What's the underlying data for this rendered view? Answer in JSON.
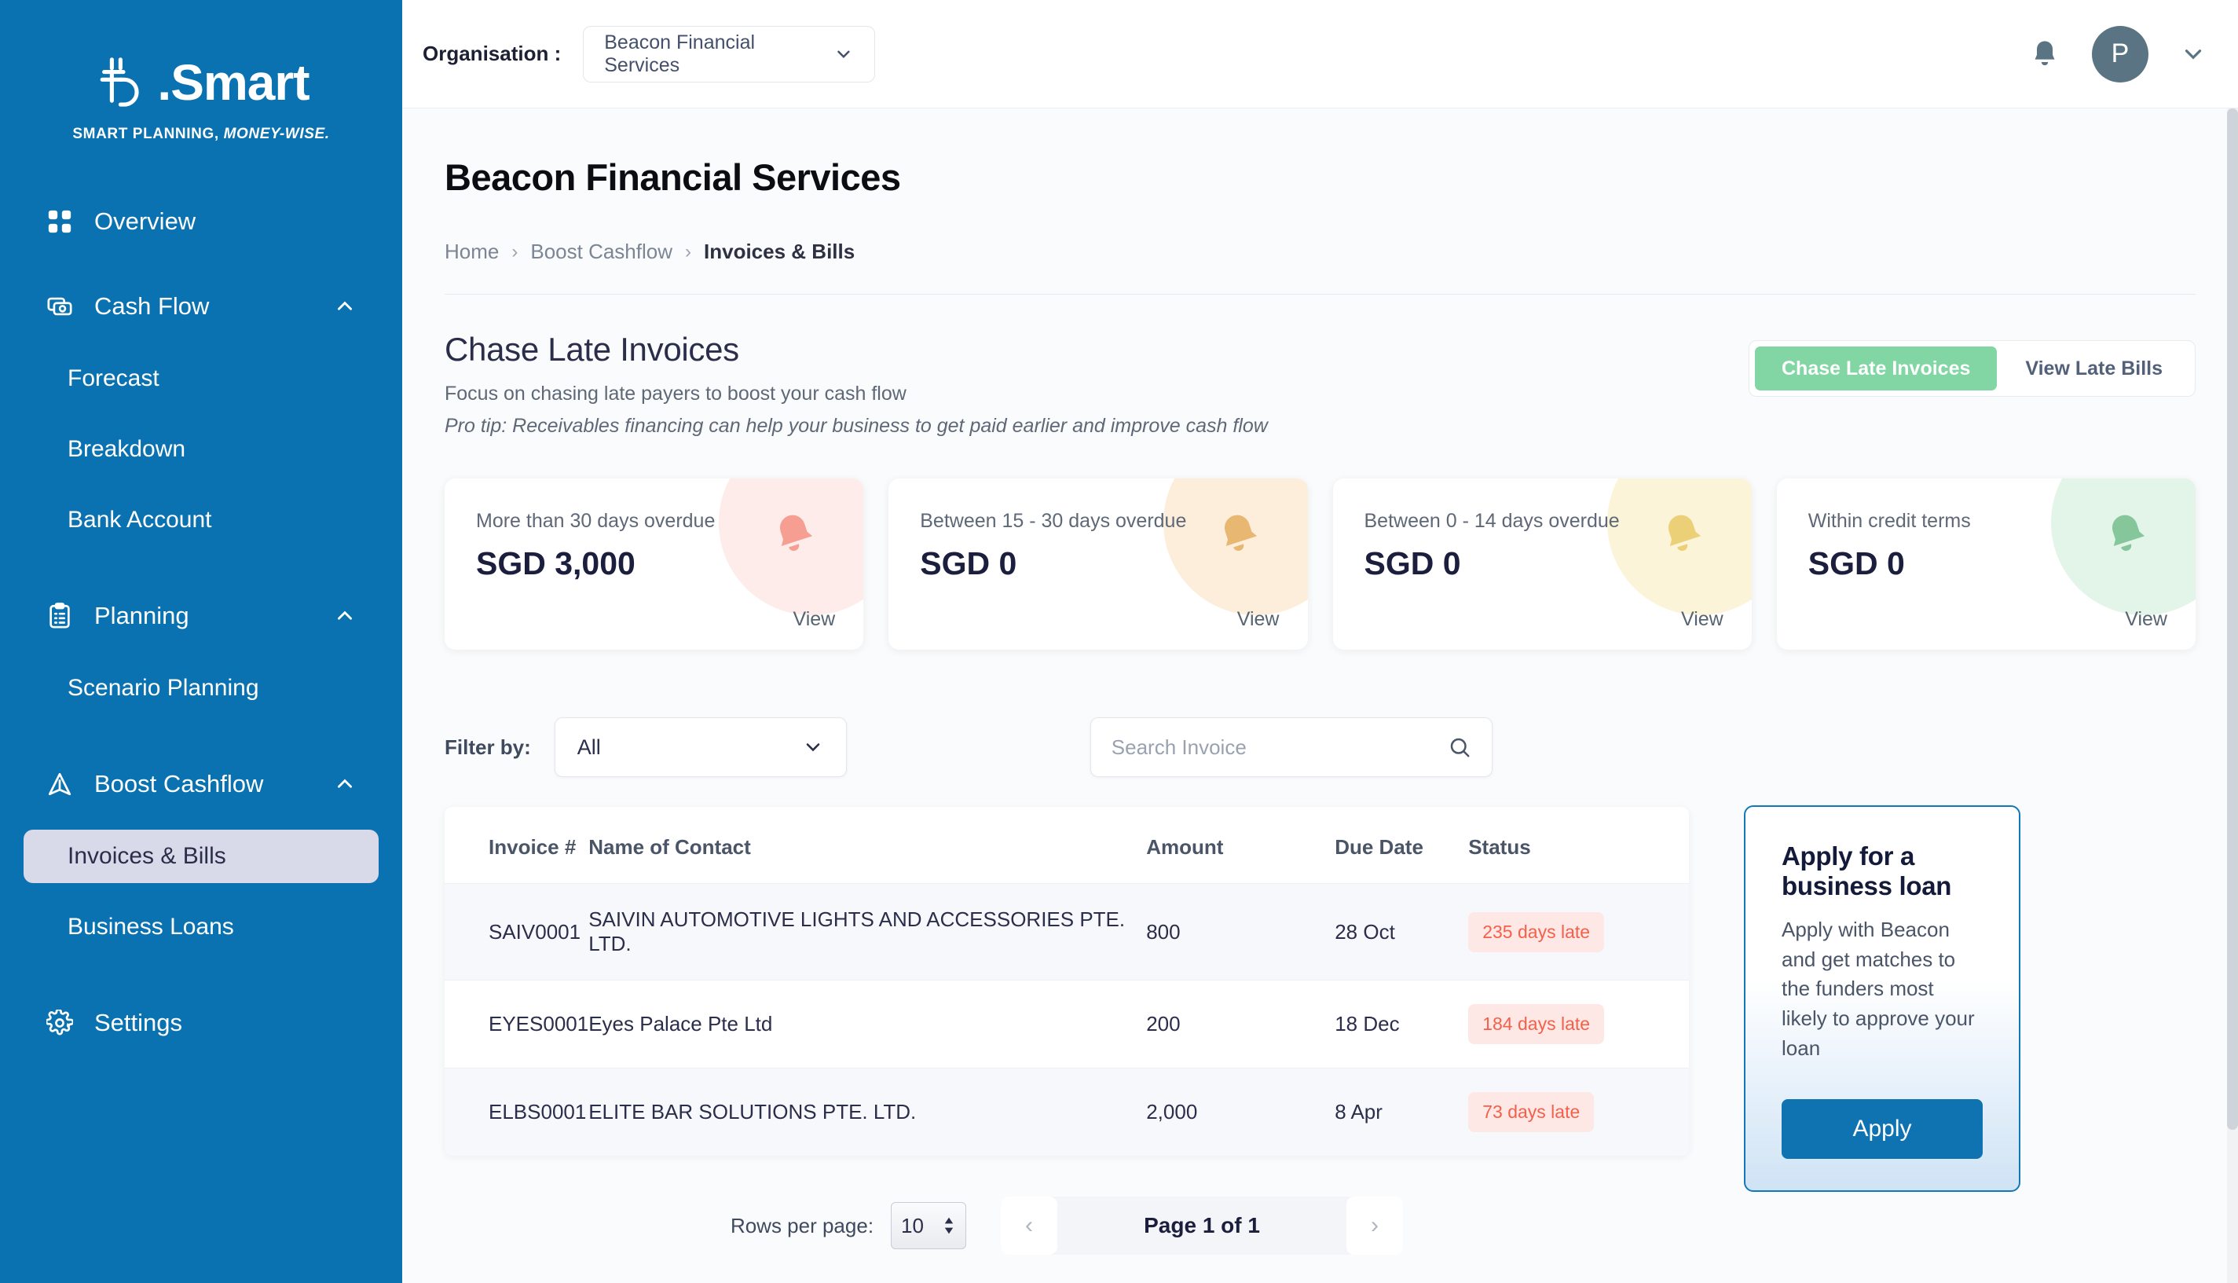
{
  "sidebar": {
    "logo_text": ".Smart",
    "logo_tagline_plain": "SMART PLANNING, ",
    "logo_tagline_italic": "MONEY-WISE.",
    "items": [
      {
        "label": "Overview",
        "icon": "grid-icon",
        "type": "item"
      },
      {
        "label": "Cash Flow",
        "icon": "money-icon",
        "type": "group",
        "expanded": true
      },
      {
        "label": "Forecast",
        "type": "sub"
      },
      {
        "label": "Breakdown",
        "type": "sub"
      },
      {
        "label": "Bank Account",
        "type": "sub"
      },
      {
        "label": "Planning",
        "icon": "clipboard-icon",
        "type": "group",
        "expanded": true
      },
      {
        "label": "Scenario Planning",
        "type": "sub"
      },
      {
        "label": "Boost Cashflow",
        "icon": "boost-icon",
        "type": "group",
        "expanded": true
      },
      {
        "label": "Invoices & Bills",
        "type": "sub",
        "active": true
      },
      {
        "label": "Business Loans",
        "type": "sub"
      },
      {
        "label": "Settings",
        "icon": "gear-icon",
        "type": "item"
      }
    ]
  },
  "topbar": {
    "org_label": "Organisation :",
    "org_value": "Beacon Financial Services",
    "avatar_initial": "P"
  },
  "page": {
    "title": "Beacon Financial Services",
    "breadcrumb": [
      "Home",
      "Boost Cashflow",
      "Invoices & Bills"
    ]
  },
  "section": {
    "title": "Chase Late Invoices",
    "subtitle": "Focus on chasing late payers to boost your cash flow",
    "pro_tip": "Pro tip: Receivables financing can help your business to get paid earlier and improve cash flow",
    "tabs": [
      {
        "label": "Chase Late Invoices",
        "active": true
      },
      {
        "label": "View Late Bills",
        "active": false
      }
    ]
  },
  "cards": [
    {
      "label": "More than 30 days overdue",
      "value": "SGD 3,000",
      "view": "View",
      "blob": "#fdece9",
      "bell": "#f79e93"
    },
    {
      "label": "Between 15 - 30 days overdue",
      "value": "SGD 0",
      "view": "View",
      "blob": "#fdeedb",
      "bell": "#e8b873"
    },
    {
      "label": "Between 0 - 14 days overdue",
      "value": "SGD 0",
      "view": "View",
      "blob": "#fcf4d8",
      "bell": "#ecd078"
    },
    {
      "label": "Within credit terms",
      "value": "SGD 0",
      "view": "View",
      "blob": "#e3f4e8",
      "bell": "#85c79a"
    }
  ],
  "filters": {
    "label": "Filter by:",
    "selected": "All",
    "search_placeholder": "Search Invoice",
    "search_value": ""
  },
  "table": {
    "columns": [
      "Invoice #",
      "Name of Contact",
      "Amount",
      "Due Date",
      "Status"
    ],
    "rows": [
      {
        "invoice": "SAIV0001",
        "contact": "SAIVIN AUTOMOTIVE LIGHTS AND ACCESSORIES PTE. LTD.",
        "amount": "800",
        "due": "28 Oct",
        "status": "235 days late"
      },
      {
        "invoice": "EYES0001",
        "contact": "Eyes Palace Pte Ltd",
        "amount": "200",
        "due": "18 Dec",
        "status": "184 days late"
      },
      {
        "invoice": "ELBS0001",
        "contact": "ELITE BAR SOLUTIONS PTE. LTD.",
        "amount": "2,000",
        "due": "8 Apr",
        "status": "73 days late"
      }
    ]
  },
  "promo": {
    "title": "Apply for a business loan",
    "body": "Apply with Beacon and get matches to the funders most likely to approve your loan",
    "button": "Apply"
  },
  "pagination": {
    "rows_label": "Rows per page:",
    "rows_value": "10",
    "page_text": "Page 1 of 1"
  },
  "colors": {
    "sidebar_blue": "#0a72b0",
    "accent_green": "#81d6a4",
    "primary_blue": "#0f72b1",
    "badge_bg": "#fde8e5",
    "badge_text": "#f4604a"
  }
}
